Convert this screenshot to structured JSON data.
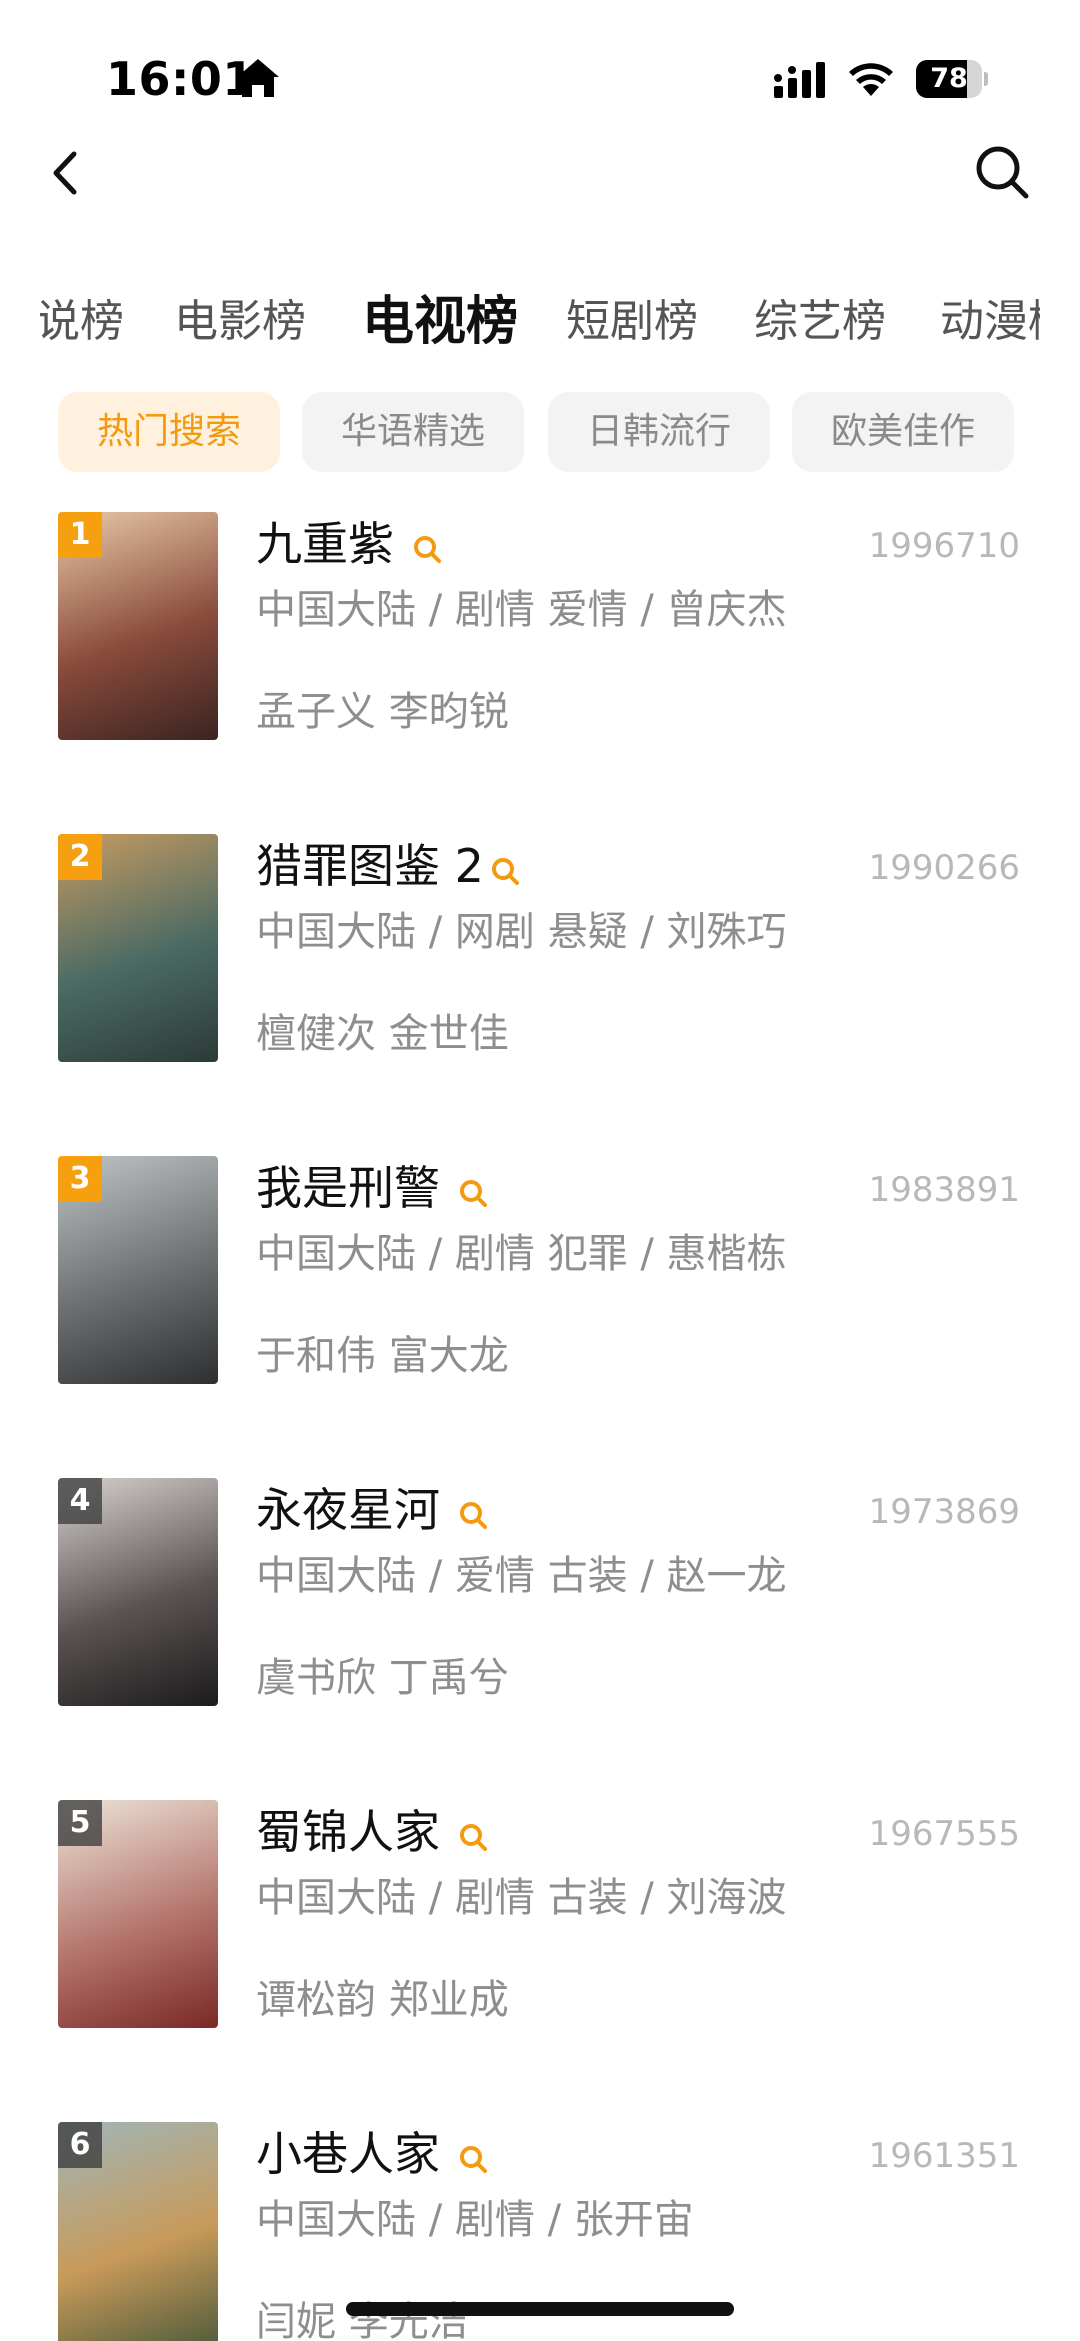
{
  "status_bar": {
    "time": "16:01",
    "battery_percent": "78",
    "battery_level": 0.78
  },
  "tabs": [
    {
      "label": "说榜",
      "active": false
    },
    {
      "label": "电影榜",
      "active": false
    },
    {
      "label": "电视榜",
      "active": true
    },
    {
      "label": "短剧榜",
      "active": false
    },
    {
      "label": "综艺榜",
      "active": false
    },
    {
      "label": "动漫榜",
      "active": false
    }
  ],
  "chips": [
    {
      "label": "热门搜索",
      "active": true
    },
    {
      "label": "华语精选",
      "active": false
    },
    {
      "label": "日韩流行",
      "active": false
    },
    {
      "label": "欧美佳作",
      "active": false
    }
  ],
  "items": [
    {
      "rank": "1",
      "title": "九重紫",
      "count": "1996710",
      "meta": "中国大陆 / 剧情 爱情 / 曾庆杰",
      "cast": "孟子义 李昀锐",
      "poster_colors": [
        "#e8c9a7",
        "#8a4b3c",
        "#3a2420"
      ]
    },
    {
      "rank": "2",
      "title": "猎罪图鉴 2",
      "count": "1990266",
      "meta": "中国大陆 / 网剧 悬疑 / 刘殊巧",
      "cast": "檀健次 金世佳",
      "poster_colors": [
        "#c79b62",
        "#4a6a63",
        "#2c3a38"
      ]
    },
    {
      "rank": "3",
      "title": "我是刑警",
      "count": "1983891",
      "meta": "中国大陆 / 剧情 犯罪 / 惠楷栋",
      "cast": "于和伟 富大龙",
      "poster_colors": [
        "#bfc4c6",
        "#6b6f70",
        "#2d2f30"
      ]
    },
    {
      "rank": "4",
      "title": "永夜星河",
      "count": "1973869",
      "meta": "中国大陆 / 爱情 古装 / 赵一龙",
      "cast": "虞书欣 丁禹兮",
      "poster_colors": [
        "#d8d2cf",
        "#5a5352",
        "#1d1b1c"
      ]
    },
    {
      "rank": "5",
      "title": "蜀锦人家",
      "count": "1967555",
      "meta": "中国大陆 / 剧情 古装 / 刘海波",
      "cast": "谭松韵 郑业成",
      "poster_colors": [
        "#ece4d8",
        "#b5766e",
        "#7a2a25"
      ]
    },
    {
      "rank": "6",
      "title": "小巷人家",
      "count": "1961351",
      "meta": "中国大陆 / 剧情 / 张开宙",
      "cast": "闫妮 李光洁",
      "poster_colors": [
        "#9fb6b8",
        "#c89a5a",
        "#4d5a3a"
      ]
    }
  ],
  "colors": {
    "accent": "#f39a11",
    "badge_top": "#f6a010",
    "badge_other": "#3c3c3c"
  }
}
